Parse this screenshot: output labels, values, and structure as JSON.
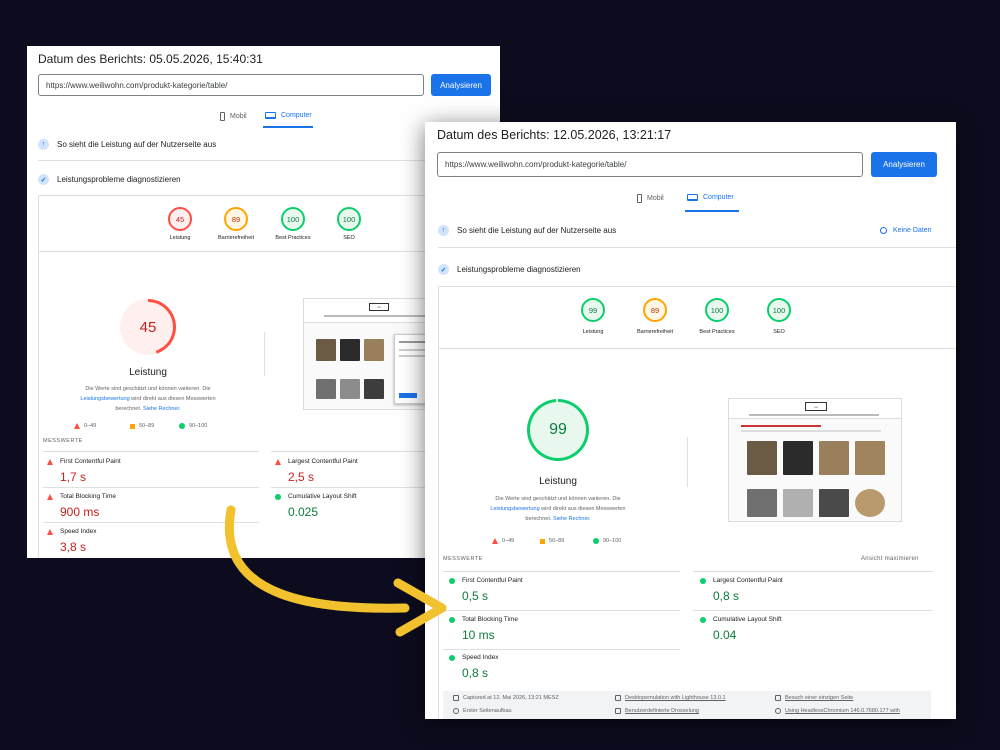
{
  "before": {
    "title": "Datum des Berichts: 05.05.2026, 15:40:31",
    "url_value": "https://www.weiliwohn.com/produkt-kategorie/table/",
    "analyze_label": "Analysieren",
    "tabs": [
      {
        "label": "Mobil"
      },
      {
        "label": "Computer"
      }
    ],
    "section_user": "So sieht die Leistung auf der Nutzerseite aus",
    "section_diag": "Leistungsprobleme diagnostizieren",
    "scores": [
      {
        "value": "45",
        "label": "Leistung"
      },
      {
        "value": "89",
        "label": "Barrierefreiheit"
      },
      {
        "value": "100",
        "label": "Best Practices"
      },
      {
        "value": "100",
        "label": "SEO"
      }
    ],
    "perf_score": "45",
    "perf_label": "Leistung",
    "note_line1": "Die Werte sind geschätzt und können variieren. Die",
    "note_link1": "Leistungsbewertung",
    "note_line2": " wird direkt aus diesen Messwerten",
    "note_line3": "berechnet. ",
    "note_link2": "Siehe Rechner.",
    "legend": [
      "0–49",
      "50–89",
      "90–100"
    ],
    "metrics_heading": "MESSWERTE",
    "metrics": [
      {
        "label": "First Contentful Paint",
        "value": "1,7 s"
      },
      {
        "label": "Largest Contentful Paint",
        "value": "2,5 s"
      },
      {
        "label": "Total Blocking Time",
        "value": "900 ms"
      },
      {
        "label": "Cumulative Layout Shift",
        "value": "0.025"
      },
      {
        "label": "Speed Index",
        "value": "3,8 s"
      }
    ]
  },
  "after": {
    "title": "Datum des Berichts: 12.05.2026, 13:21:17",
    "url_value": "https://www.weiliwohn.com/produkt-kategorie/table/",
    "analyze_label": "Analysieren",
    "tabs": [
      {
        "label": "Mobil"
      },
      {
        "label": "Computer"
      }
    ],
    "section_user": "So sieht die Leistung auf der Nutzerseite aus",
    "no_data": "Keine Daten",
    "section_diag": "Leistungsprobleme diagnostizieren",
    "scores": [
      {
        "value": "99",
        "label": "Leistung"
      },
      {
        "value": "89",
        "label": "Barrierefreiheit"
      },
      {
        "value": "100",
        "label": "Best Practices"
      },
      {
        "value": "100",
        "label": "SEO"
      }
    ],
    "perf_score": "99",
    "perf_label": "Leistung",
    "note_line1": "Die Werte sind geschätzt und können variieren. Die",
    "note_link1": "Leistungsbewertung",
    "note_line2": " wird direkt aus diesen Messwerten",
    "note_line3": "berechnet. ",
    "note_link2": "Siehe Rechner.",
    "legend": [
      "0–49",
      "50–89",
      "90–100"
    ],
    "metrics_heading": "MESSWERTE",
    "maximize": "Ansicht maximieren",
    "metrics": [
      {
        "label": "First Contentful Paint",
        "value": "0,5 s"
      },
      {
        "label": "Largest Contentful Paint",
        "value": "0,8 s"
      },
      {
        "label": "Total Blocking Time",
        "value": "10 ms"
      },
      {
        "label": "Cumulative Layout Shift",
        "value": "0.04"
      },
      {
        "label": "Speed Index",
        "value": "0,8 s"
      }
    ],
    "footer": [
      "Captured at 12. Mai 2026, 13:21 MESZ",
      "Desktopemulation with Lighthouse 13.0.1",
      "Besuch einer einzigen Seite",
      "Erster Seitenaufbau",
      "Benutzerdefinierte Drosselung",
      "Using HeadlessChromium 146.0.7680.177 with"
    ]
  },
  "colors": {
    "background": "#0c0c1e",
    "arrow": "#f2c12e",
    "accent": "#1a73e8",
    "poor": "#ff4e42",
    "average": "#ffa400",
    "good": "#0cce6b"
  }
}
